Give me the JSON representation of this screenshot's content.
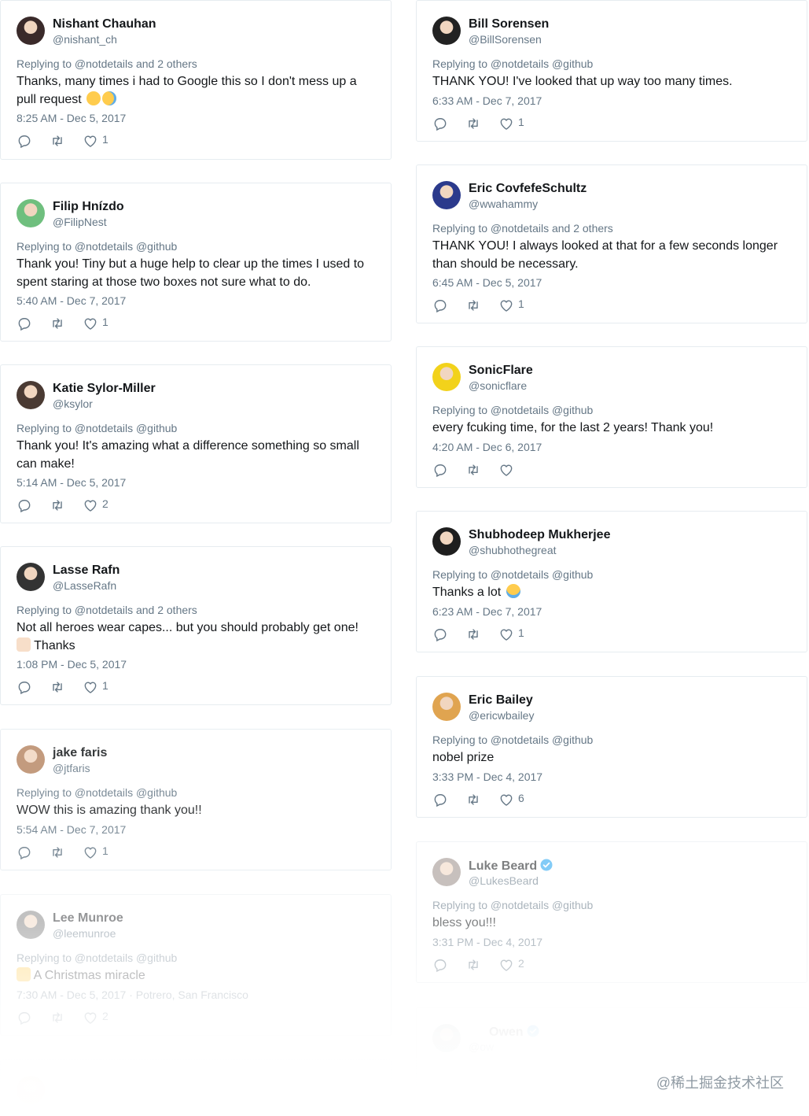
{
  "left": [
    {
      "name": "Nishant Chauhan",
      "handle": "@nishant_ch",
      "reply": "Replying to @notdetails and 2 others",
      "text": "Thanks, many times i had to Google this so I don't mess up a pull request",
      "time": "8:25 AM - Dec 5, 2017",
      "likes": "1",
      "emoji": [
        "grinning-face",
        "tears-of-joy-face"
      ],
      "avatar_color": "#3a2a2a"
    },
    {
      "name": "Filip Hnízdo",
      "handle": "@FilipNest",
      "reply": "Replying to @notdetails @github",
      "text": "Thank you! Tiny but a huge help to clear up the times I used to spent staring at those two boxes not sure what to do.",
      "time": "5:40 AM - Dec 7, 2017",
      "likes": "1",
      "avatar_color": "#6fbf7e"
    },
    {
      "name": "Katie Sylor-Miller",
      "handle": "@ksylor",
      "reply": "Replying to @notdetails @github",
      "text": "Thank you! It's amazing what a difference something so small can make!",
      "time": "5:14 AM - Dec 5, 2017",
      "likes": "2",
      "avatar_color": "#4a3a33"
    },
    {
      "name": "Lasse Rafn",
      "handle": "@LasseRafn",
      "reply": "Replying to @notdetails and 2 others",
      "text": "Not all heroes wear capes... but you should probably get one!",
      "text2": "Thanks",
      "time": "1:08 PM - Dec 5, 2017",
      "likes": "1",
      "emoji": [
        "folded-hands"
      ],
      "avatar_color": "#333333"
    },
    {
      "name": "jake faris",
      "handle": "@jtfaris",
      "reply": "Replying to @notdetails @github",
      "text": "WOW this is amazing thank you!!",
      "time": "5:54 AM - Dec 7, 2017",
      "likes": "1",
      "avatar_color": "#b98a68"
    },
    {
      "name": "Lee Munroe",
      "handle": "@leemunroe",
      "reply": "Replying to @notdetails @github",
      "text": "A Christmas miracle",
      "time": "7:30 AM - Dec 5, 2017 · Potrero, San Francisco",
      "likes": "2",
      "emoji": [
        "raising-hands"
      ],
      "avatar_color": "#777777"
    }
  ],
  "right": [
    {
      "name": "Bill Sorensen",
      "handle": "@BillSorensen",
      "reply": "Replying to @notdetails @github",
      "text": "THANK YOU! I've looked that up way too many times.",
      "time": "6:33 AM - Dec 7, 2017",
      "likes": "1",
      "avatar_color": "#222222"
    },
    {
      "name": "Eric CovfefeSchultz",
      "handle": "@wwahammy",
      "reply": "Replying to @notdetails and 2 others",
      "text": "THANK YOU! I always looked at that for a few seconds longer than should be necessary.",
      "time": "6:45 AM - Dec 5, 2017",
      "likes": "1",
      "avatar_color": "#2b3a8c"
    },
    {
      "name": "SonicFlare",
      "handle": "@sonicflare",
      "reply": "Replying to @notdetails @github",
      "text": "every fcuking time, for the last 2 years! Thank you!",
      "time": "4:20 AM - Dec 6, 2017",
      "likes": "",
      "avatar_color": "#f2d21b"
    },
    {
      "name": "Shubhodeep Mukherjee",
      "handle": "@shubhothegreat",
      "reply": "Replying to @notdetails @github",
      "text": "Thanks a lot",
      "time": "6:23 AM - Dec 7, 2017",
      "likes": "1",
      "emoji": [
        "crying-face"
      ],
      "avatar_color": "#1e1e1e"
    },
    {
      "name": "Eric Bailey",
      "handle": "@ericwbailey",
      "reply": "Replying to @notdetails @github",
      "text": "nobel prize",
      "time": "3:33 PM - Dec 4, 2017",
      "likes": "6",
      "avatar_color": "#e0a450"
    },
    {
      "name": "Luke Beard",
      "handle": "@LukesBeard",
      "reply": "Replying to @notdetails @github",
      "text": "bless you!!!",
      "time": "3:31 PM - Dec 4, 2017",
      "likes": "2",
      "verified": true,
      "avatar_color": "#9a8d88"
    },
    {
      "name": "Owen",
      "handle": "@ow",
      "verified": true,
      "avatar_color": "#9aa7a8"
    }
  ],
  "bottom_left_stub": {
    "avatar_color": "#d9a24e"
  },
  "watermark": "@稀土掘金技术社区",
  "colors": {
    "text": "#14171a",
    "muted": "#657786",
    "border": "#e6ecf0",
    "verified": "#1da1f2",
    "icon": "#657786"
  }
}
